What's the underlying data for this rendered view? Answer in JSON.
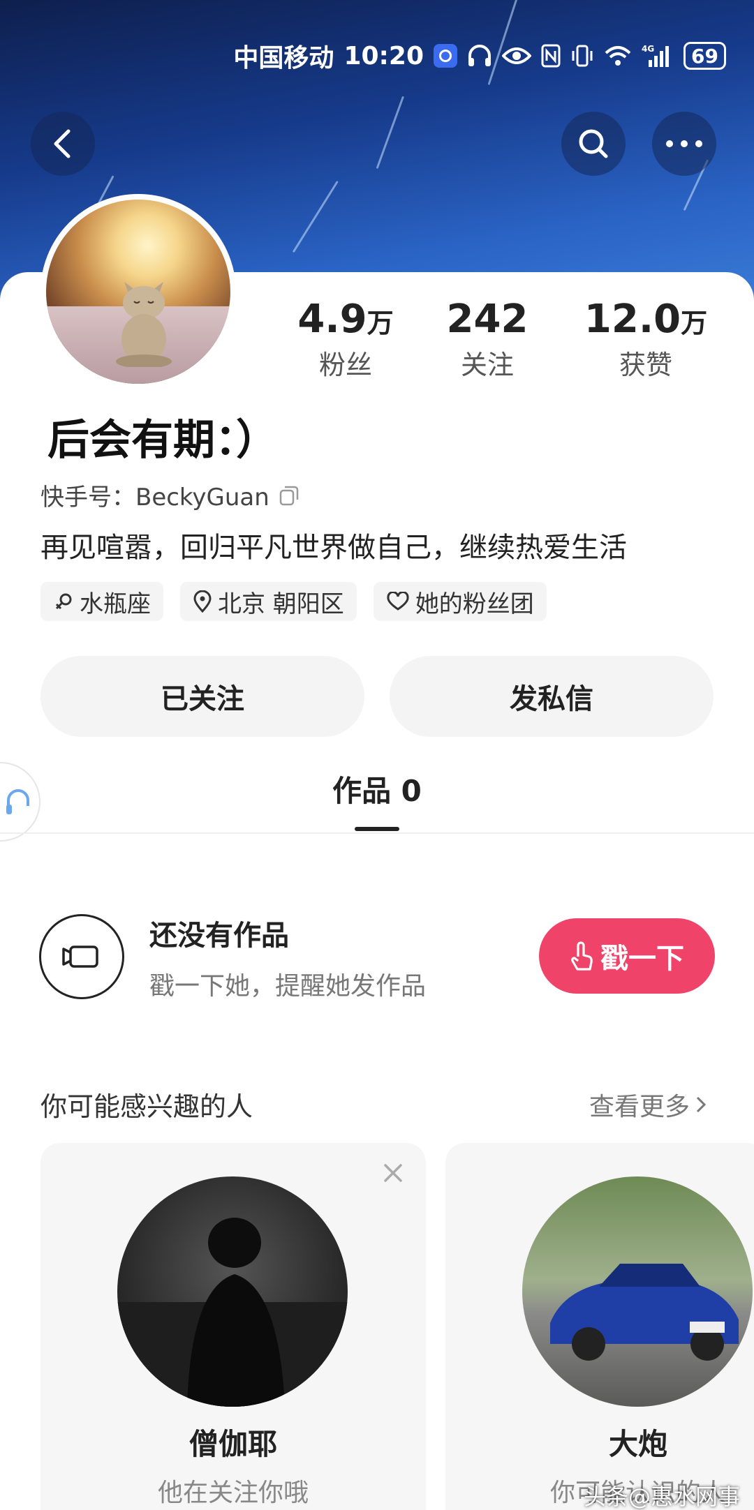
{
  "status_bar": {
    "carrier": "中国移动",
    "time": "10:20",
    "battery": "69",
    "network": "4G"
  },
  "profile": {
    "stats": [
      {
        "value": "4.9",
        "unit": "万",
        "label": "粉丝"
      },
      {
        "value": "242",
        "unit": "",
        "label": "关注"
      },
      {
        "value": "12.0",
        "unit": "万",
        "label": "获赞"
      }
    ],
    "name": "后会有期：）",
    "kuaishou_id": "快手号：BeckyGuan",
    "bio": "再见喧嚣，回归平凡世界做自己，继续热爱生活",
    "tags": [
      {
        "icon": "female-icon",
        "label": "水瓶座"
      },
      {
        "icon": "location-pin-icon",
        "label": "北京 朝阳区"
      },
      {
        "icon": "heart-icon",
        "label": "她的粉丝团"
      }
    ]
  },
  "actions": {
    "followed": "已关注",
    "message": "发私信"
  },
  "tabs": {
    "works": "作品 0"
  },
  "empty_state": {
    "title": "还没有作品",
    "subtitle": "戳一下她，提醒她发作品",
    "poke_label": "戳一下"
  },
  "recommend": {
    "title": "你可能感兴趣的人",
    "more": "查看更多",
    "users": [
      {
        "name": "僧伽耶",
        "subtitle": "他在关注你哦"
      },
      {
        "name": "大炮",
        "subtitle": "你可能认识的人"
      }
    ]
  },
  "watermark": "头条@惠水网事",
  "colors": {
    "accent": "#f0436a",
    "banner": "#1d4aa8"
  }
}
